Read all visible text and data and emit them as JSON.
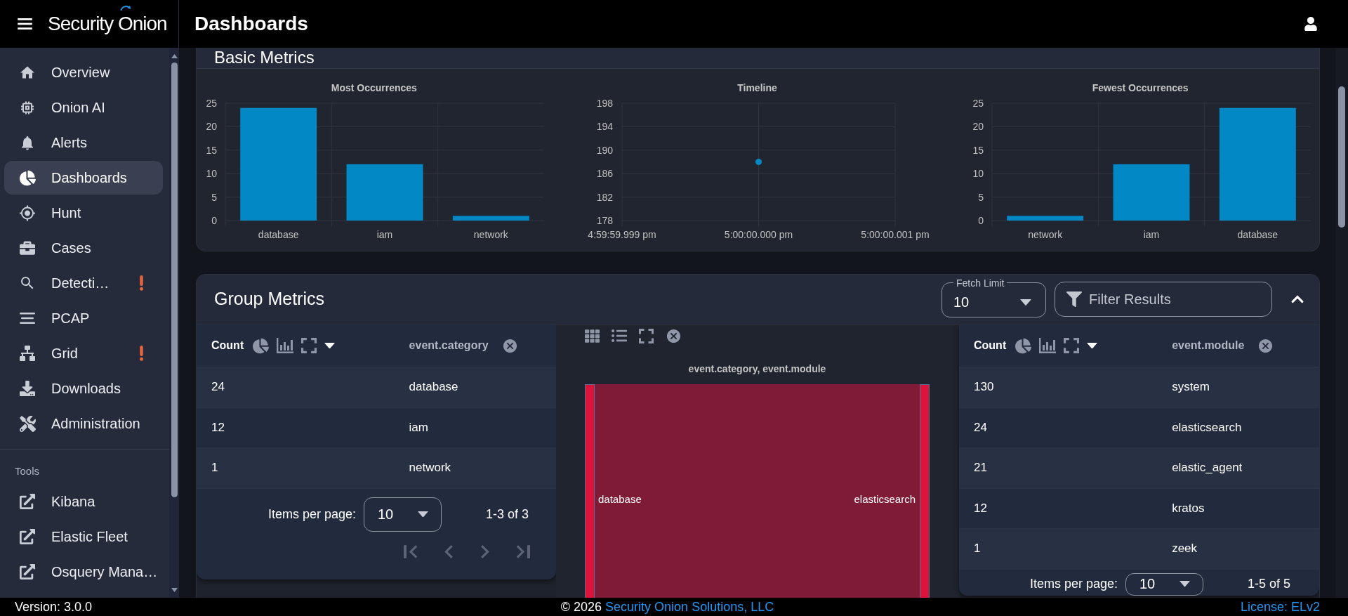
{
  "header": {
    "brand": "Security Onion",
    "title": "Dashboards"
  },
  "sidebar": {
    "items": [
      {
        "label": "Overview",
        "selected": false,
        "warning": false
      },
      {
        "label": "Onion AI",
        "selected": false,
        "warning": false
      },
      {
        "label": "Alerts",
        "selected": false,
        "warning": false
      },
      {
        "label": "Dashboards",
        "selected": true,
        "warning": false
      },
      {
        "label": "Hunt",
        "selected": false,
        "warning": false
      },
      {
        "label": "Cases",
        "selected": false,
        "warning": false
      },
      {
        "label": "Detecti…",
        "selected": false,
        "warning": true
      },
      {
        "label": "PCAP",
        "selected": false,
        "warning": false
      },
      {
        "label": "Grid",
        "selected": false,
        "warning": true
      },
      {
        "label": "Downloads",
        "selected": false,
        "warning": false
      },
      {
        "label": "Administration",
        "selected": false,
        "warning": false
      }
    ],
    "tools": {
      "title": "Tools",
      "items": [
        {
          "label": "Kibana"
        },
        {
          "label": "Elastic Fleet"
        },
        {
          "label": "Osquery Mana…"
        }
      ]
    }
  },
  "basic_metrics": {
    "title": "Basic Metrics",
    "charts": [
      {
        "chart_data": {
          "type": "bar",
          "title": "Most Occurrences",
          "categories": [
            "database",
            "iam",
            "network"
          ],
          "series": [
            {
              "color": "#0288c5",
              "values": [
                24,
                12,
                1
              ]
            }
          ],
          "ylim": [
            0,
            25
          ],
          "yticks": [
            0,
            5,
            10,
            15,
            20,
            25
          ],
          "grid": true
        }
      },
      {
        "chart_data": {
          "type": "scatter",
          "title": "Timeline",
          "x": [
            "4:59:59.999 pm",
            "5:00:00.000 pm",
            "5:00:00.001 pm"
          ],
          "series": [
            {
              "color": "#0288c5",
              "values": [
                null,
                188,
                null
              ]
            }
          ],
          "ylim": [
            178,
            198
          ],
          "yticks": [
            178,
            182,
            186,
            190,
            194,
            198
          ],
          "grid": true
        }
      },
      {
        "chart_data": {
          "type": "bar",
          "title": "Fewest Occurrences",
          "categories": [
            "network",
            "iam",
            "database"
          ],
          "series": [
            {
              "color": "#0288c5",
              "values": [
                1,
                12,
                24
              ]
            }
          ],
          "ylim": [
            0,
            25
          ],
          "yticks": [
            0,
            5,
            10,
            15,
            20,
            25
          ],
          "grid": true
        }
      }
    ]
  },
  "group_metrics": {
    "title": "Group Metrics",
    "fetch_limit": {
      "label": "Fetch Limit",
      "value": "10"
    },
    "filter": {
      "placeholder": "Filter Results"
    },
    "expanded": true,
    "tables": [
      {
        "columns": [
          "Count",
          "event.category"
        ],
        "rows": [
          [
            "24",
            "database"
          ],
          [
            "12",
            "iam"
          ],
          [
            "1",
            "network"
          ]
        ],
        "footer": {
          "items_per_page_label": "Items per page:",
          "items_per_page": "10",
          "range": "1-3 of 3"
        },
        "pagination": [
          {
            "disabled": true
          },
          {
            "disabled": true
          },
          {
            "disabled": true
          },
          {
            "disabled": true
          }
        ]
      },
      {
        "columns": [
          "Count",
          "event.module"
        ],
        "rows": [
          [
            "130",
            "system"
          ],
          [
            "24",
            "elasticsearch"
          ],
          [
            "21",
            "elastic_agent"
          ],
          [
            "12",
            "kratos"
          ],
          [
            "1",
            "zeek"
          ]
        ],
        "footer": {
          "items_per_page_label": "Items per page:",
          "items_per_page": "10",
          "range": "1-5 of 5"
        }
      }
    ],
    "sankey": {
      "title": "event.category, event.module",
      "source": "database",
      "target": "elasticsearch"
    }
  },
  "footer": {
    "version": "Version: 3.0.0",
    "copyright": "© 2026",
    "company": "Security Onion Solutions, LLC",
    "license": "License: ELv2"
  }
}
